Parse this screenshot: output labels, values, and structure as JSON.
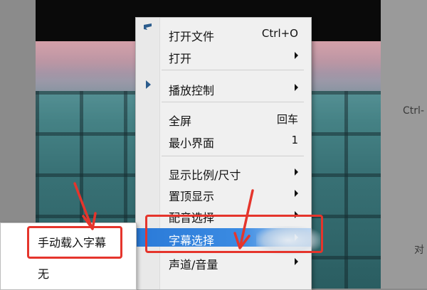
{
  "menu": {
    "items": [
      {
        "id": "open-file",
        "label": "打开文件",
        "shortcut": "Ctrl+O"
      },
      {
        "id": "open",
        "label": "打开",
        "submenu": true
      },
      {
        "id": "playback-control",
        "label": "播放控制",
        "submenu": true
      },
      {
        "id": "fullscreen",
        "label": "全屏",
        "shortcut": "回车"
      },
      {
        "id": "minimal-ui",
        "label": "最小界面",
        "shortcut": "1"
      },
      {
        "id": "aspect-ratio",
        "label": "显示比例/尺寸",
        "submenu": true
      },
      {
        "id": "always-on-top",
        "label": "置顶显示",
        "submenu": true
      },
      {
        "id": "dub-select",
        "label": "配音选择",
        "submenu": true
      },
      {
        "id": "subtitle-select",
        "label": "字幕选择",
        "submenu": true,
        "selected": true
      },
      {
        "id": "channel-volume",
        "label": "声道/音量",
        "submenu": true
      }
    ]
  },
  "submenu": {
    "items": [
      {
        "label": "手动载入字幕"
      },
      {
        "label": "无"
      }
    ]
  },
  "background": {
    "right_panel_texts": [
      "Ctrl-",
      "对"
    ]
  },
  "colors": {
    "annotation": "#e5352c",
    "selected": "#2a7ad8"
  },
  "icons": {
    "gutter_top": "open-file-icon",
    "gutter_play": "play-triangle-icon"
  }
}
